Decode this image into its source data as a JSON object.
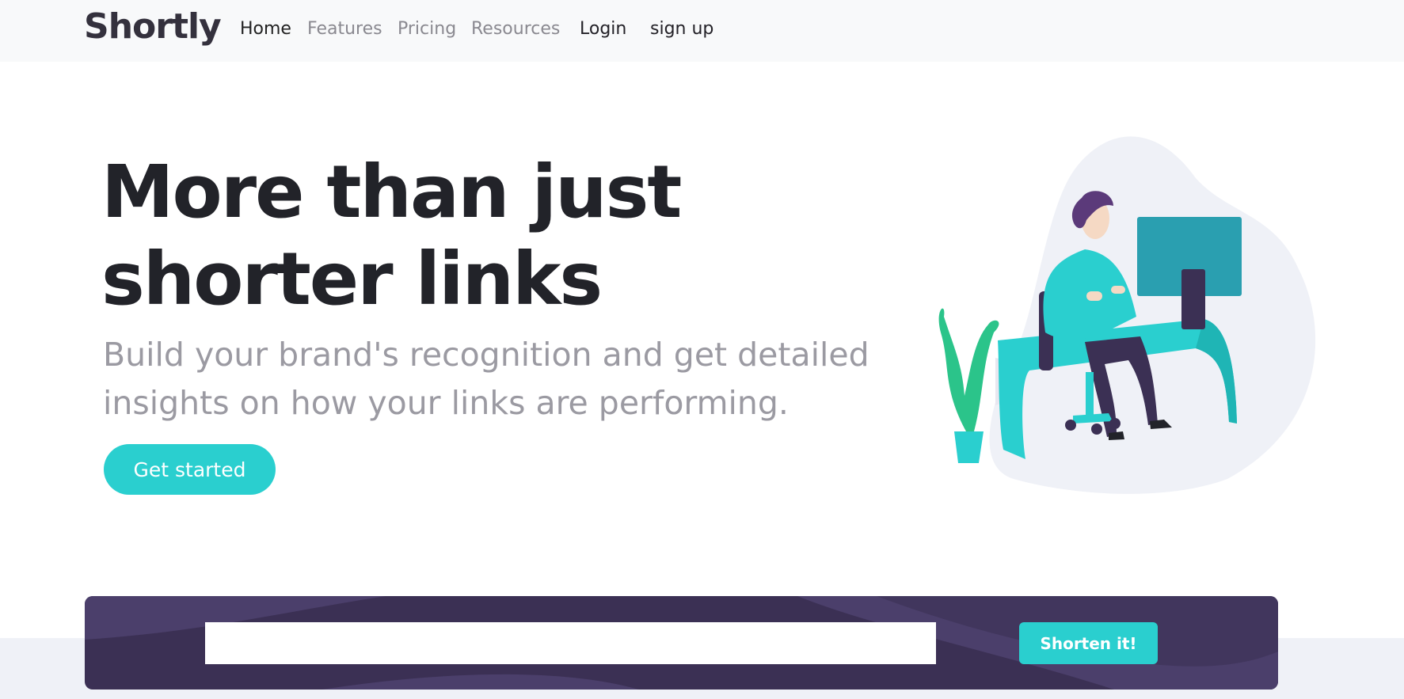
{
  "brand": {
    "name": "Shortly"
  },
  "nav": {
    "links": [
      {
        "label": "Home"
      },
      {
        "label": "Features"
      },
      {
        "label": "Pricing"
      },
      {
        "label": "Resources"
      }
    ],
    "login": "Login",
    "signup": "sign up"
  },
  "hero": {
    "title": "More than just shorter links",
    "subtitle": "Build your brand's recognition and get detailed insights on how your links are performing.",
    "cta": "Get started",
    "illustration": "person-working-at-desk-illustration"
  },
  "shorten": {
    "input_value": "",
    "input_placeholder": "",
    "button_label": "Shorten it!"
  },
  "colors": {
    "accent": "#2acfcf",
    "dark_violet": "#3b3054",
    "very_dark": "#222329",
    "gray": "#9b9aa2",
    "navbar_bg": "#f8f9fa",
    "blob": "#eff1f7"
  }
}
